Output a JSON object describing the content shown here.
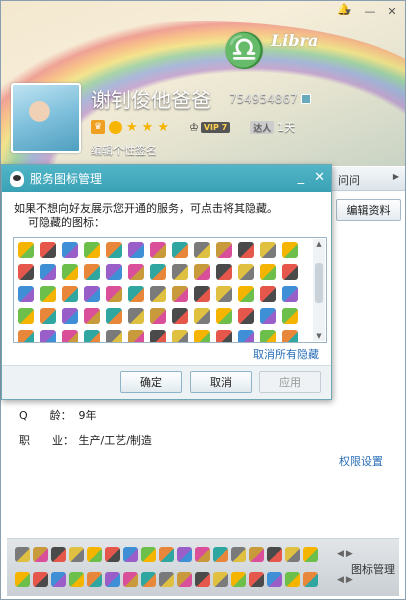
{
  "profile": {
    "nickname": "谢钊俊他爸爸",
    "qq_number": "754954867",
    "vip_level": "VIP 7",
    "talent_label": "达人",
    "talent_days": "1天",
    "signature": "编辑个性签名",
    "banner_text": "Libra",
    "stars": 3
  },
  "tabs": {
    "ask": "问问",
    "arrow": "▶"
  },
  "edit_button": "编辑资料",
  "info": [
    {
      "key": "Q　　龄：",
      "value": "9年"
    },
    {
      "key": "职　　业：",
      "value": "生产/工艺/制造"
    }
  ],
  "permission_link": "权限设置",
  "icon_manager": "图标管理",
  "dialog": {
    "title": "服务图标管理",
    "description": "如果不想向好友展示您开通的服务，可点击将其隐藏。",
    "hideable_label": "可隐藏的图标：",
    "unhide_all": "取消所有隐藏",
    "ok": "确定",
    "cancel": "取消",
    "apply": "应用"
  },
  "icon_palette": [
    "#f4b400",
    "#e5574a",
    "#3f8fd6",
    "#6cbf4a",
    "#e8863a",
    "#9a5ec8",
    "#d94f9a",
    "#2fa6a0",
    "#7a7a7a",
    "#c89a3c",
    "#4a4a4a",
    "#e0c040"
  ]
}
